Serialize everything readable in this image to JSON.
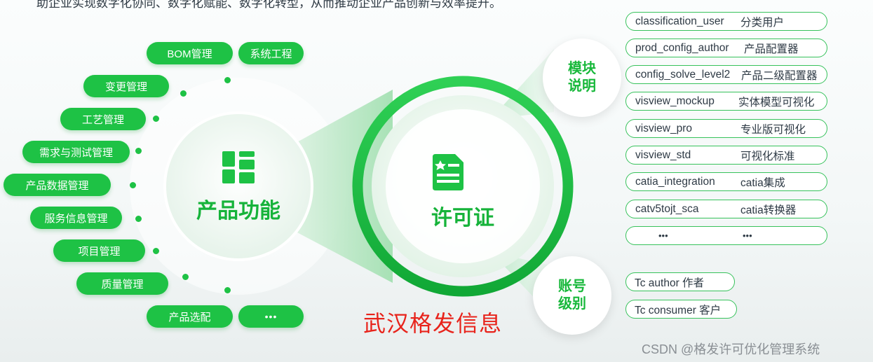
{
  "intro_text": "助企业实现数字化协同、数字化赋能、数字化转型，从而推动企业产品创新与效率提升。",
  "product_function": {
    "title": "产品功能",
    "icon": "grid-layout-icon",
    "items": [
      "BOM管理",
      "系统工程",
      "变更管理",
      "工艺管理",
      "需求与测试管理",
      "产品数据管理",
      "服务信息管理",
      "项目管理",
      "质量管理",
      "产品选配",
      "•••"
    ]
  },
  "license": {
    "title": "许可证",
    "icon": "document-star-icon"
  },
  "module_section": {
    "title_line1": "模块",
    "title_line2": "说明",
    "items": [
      {
        "key": "classification_user",
        "value": "分类用户"
      },
      {
        "key": "prod_config_author",
        "value": "产品配置器"
      },
      {
        "key": "config_solve_level2",
        "value": "产品二级配置器"
      },
      {
        "key": "visview_mockup",
        "value": "实体模型可视化"
      },
      {
        "key": "visview_pro",
        "value": "专业版可视化"
      },
      {
        "key": "visview_std",
        "value": "可视化标准"
      },
      {
        "key": "catia_integration",
        "value": "catia集成"
      },
      {
        "key": "catv5tojt_sca",
        "value": "catia转换器"
      },
      {
        "key": "•••",
        "value": "•••"
      }
    ]
  },
  "account_section": {
    "title_line1": "账号",
    "title_line2": "级别",
    "items": [
      "Tc author 作者",
      "Tc consumer 客户"
    ]
  },
  "brand": "武汉格发信息",
  "watermark": "CSDN @格发许可优化管理系统",
  "colors": {
    "accent_green": "#1ec245",
    "brand_red": "#e8231b"
  }
}
